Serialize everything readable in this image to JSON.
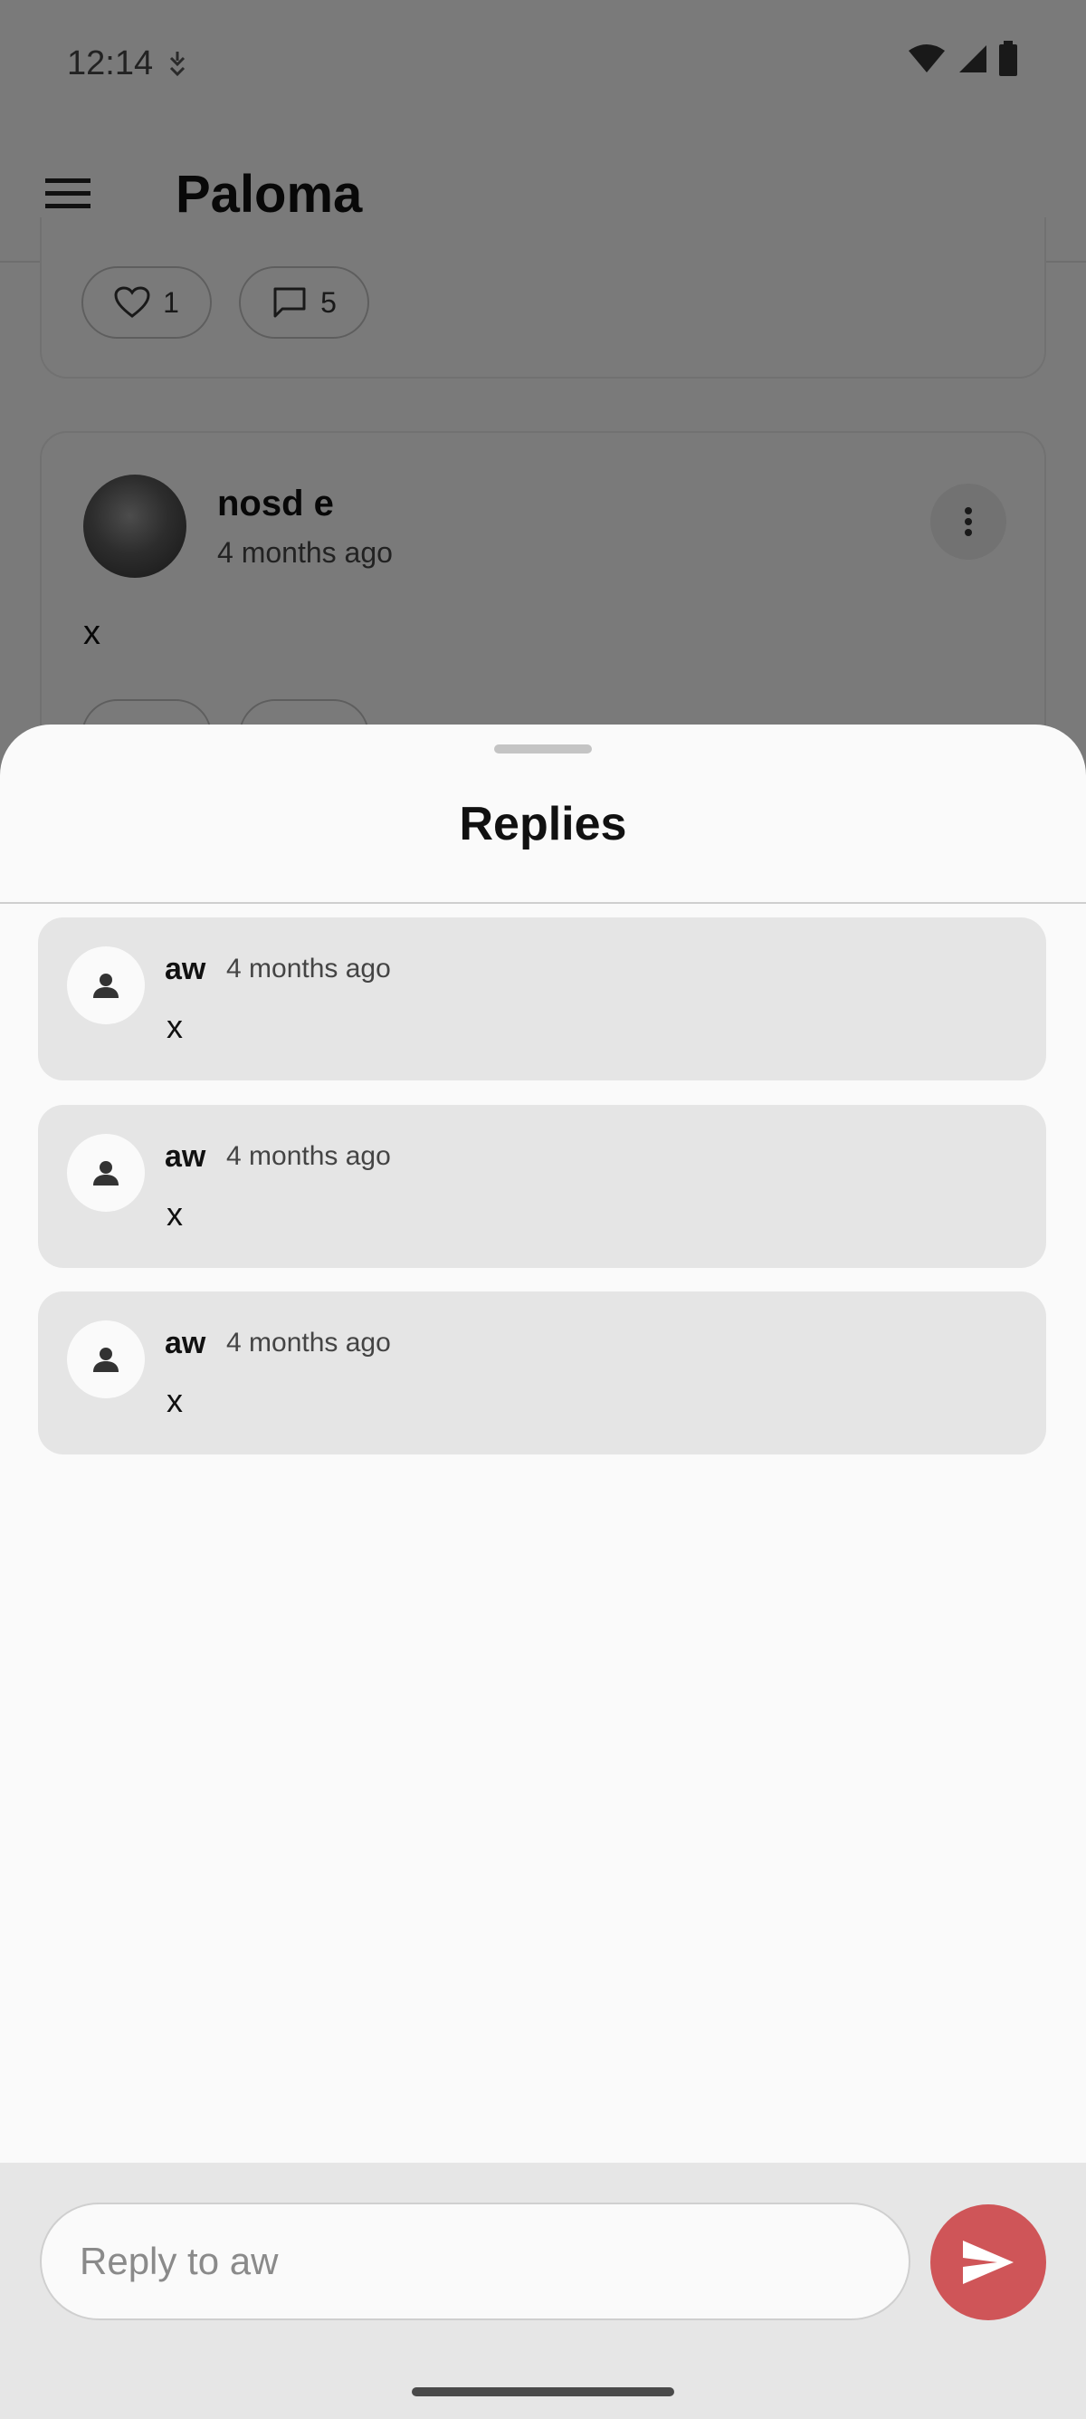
{
  "status_bar": {
    "time": "12:14"
  },
  "app_bar": {
    "title": "Paloma"
  },
  "background_post_top": {
    "likes": "1",
    "comments": "5"
  },
  "background_post": {
    "author": "nosd e",
    "time": "4 months ago",
    "body": "x"
  },
  "sheet": {
    "title": "Replies",
    "replies": [
      {
        "author": "aw",
        "time": "4 months ago",
        "text": "x"
      },
      {
        "author": "aw",
        "time": "4 months ago",
        "text": "x"
      },
      {
        "author": "aw",
        "time": "4 months ago",
        "text": "x"
      }
    ]
  },
  "composer": {
    "placeholder": "Reply to aw"
  },
  "colors": {
    "accent": "#cf5558",
    "reply_card": "#e5e5e5",
    "sheet_background": "#fafafa"
  },
  "icons": [
    "menu-icon",
    "heart-icon",
    "comment-icon",
    "more-vert-icon",
    "person-icon",
    "send-icon",
    "wifi-icon",
    "signal-icon",
    "battery-icon"
  ]
}
